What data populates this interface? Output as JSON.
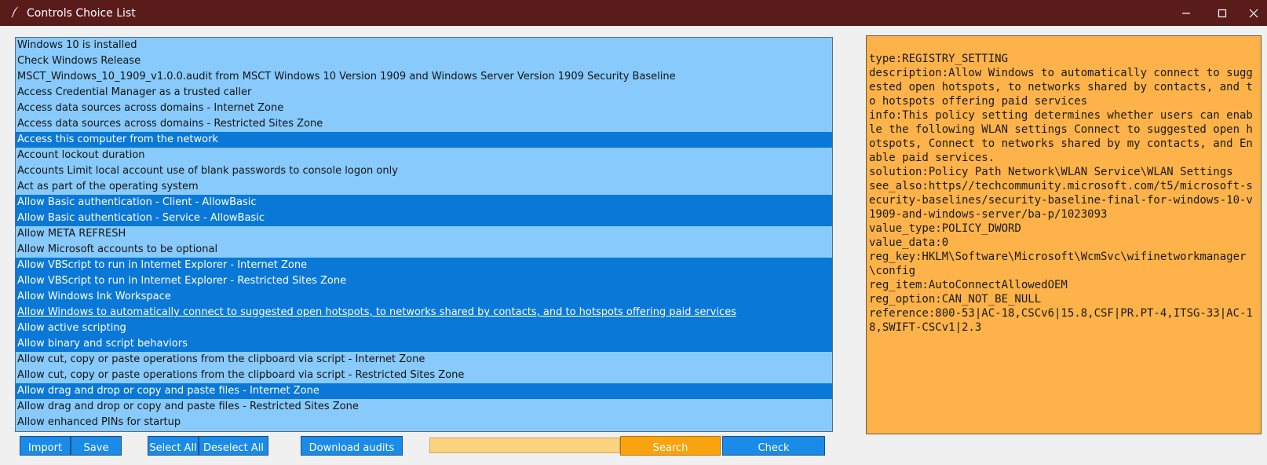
{
  "window": {
    "title": "Controls Choice List",
    "app_icon": "feather-icon",
    "controls": [
      "minimize-icon",
      "maximize-icon",
      "close-icon"
    ]
  },
  "list": {
    "items": [
      {
        "label": "Windows 10 is installed",
        "selected": false
      },
      {
        "label": "Check Windows Release",
        "selected": false
      },
      {
        "label": "MSCT_Windows_10_1909_v1.0.0.audit from MSCT Windows 10 Version 1909 and Windows Server Version 1909 Security Baseline",
        "selected": false
      },
      {
        "label": "Access Credential Manager as a trusted caller",
        "selected": false
      },
      {
        "label": "Access data sources across domains - Internet Zone",
        "selected": false
      },
      {
        "label": "Access data sources across domains - Restricted Sites Zone",
        "selected": false
      },
      {
        "label": "Access this computer from the network",
        "selected": true
      },
      {
        "label": "Account lockout duration",
        "selected": false
      },
      {
        "label": "Accounts Limit local account use of blank passwords to console logon only",
        "selected": false
      },
      {
        "label": "Act as part of the operating system",
        "selected": false
      },
      {
        "label": "Allow Basic authentication - Client - AllowBasic",
        "selected": true
      },
      {
        "label": "Allow Basic authentication - Service - AllowBasic",
        "selected": true
      },
      {
        "label": "Allow META REFRESH",
        "selected": false
      },
      {
        "label": "Allow Microsoft accounts to be optional",
        "selected": false
      },
      {
        "label": "Allow VBScript to run in Internet Explorer - Internet Zone",
        "selected": true
      },
      {
        "label": "Allow VBScript to run in Internet Explorer - Restricted Sites Zone",
        "selected": true
      },
      {
        "label": "Allow Windows Ink Workspace",
        "selected": true
      },
      {
        "label": "Allow Windows to automatically connect to suggested open hotspots, to networks shared by contacts, and to hotspots offering paid services",
        "selected": true,
        "active": true
      },
      {
        "label": "Allow active scripting",
        "selected": true
      },
      {
        "label": "Allow binary and script behaviors",
        "selected": true
      },
      {
        "label": "Allow cut, copy or paste operations from the clipboard via script - Internet Zone",
        "selected": false
      },
      {
        "label": "Allow cut, copy or paste operations from the clipboard via script - Restricted Sites Zone",
        "selected": false
      },
      {
        "label": "Allow drag and drop or copy and paste files - Internet Zone",
        "selected": true
      },
      {
        "label": "Allow drag and drop or copy and paste files - Restricted Sites Zone",
        "selected": false
      },
      {
        "label": "Allow enhanced PINs for startup",
        "selected": false
      }
    ]
  },
  "details": {
    "lines": [
      "type:REGISTRY_SETTING",
      "description:Allow Windows to automatically connect to suggested open hotspots, to networks shared by contacts, and to hotspots offering paid services",
      "info:This policy setting determines whether users can enable the following WLAN settings Connect to suggested open hotspots, Connect to networks shared by my contacts, and Enable paid services.",
      "solution:Policy Path Network\\WLAN Service\\WLAN Settings",
      "see_also:https//techcommunity.microsoft.com/t5/microsoft-security-baselines/security-baseline-final-for-windows-10-v1909-and-windows-server/ba-p/1023093",
      "value_type:POLICY_DWORD",
      "value_data:0",
      "reg_key:HKLM\\Software\\Microsoft\\WcmSvc\\wifinetworkmanager\\config",
      "reg_item:AutoConnectAllowedOEM",
      "reg_option:CAN_NOT_BE_NULL",
      "reference:800-53|AC-18,CSCv6|15.8,CSF|PR.PT-4,ITSG-33|AC-18,SWIFT-CSCv1|2.3"
    ]
  },
  "buttons": {
    "import": "Import",
    "save": "Save",
    "select_all": "Select All",
    "deselect_all": "Deselect All",
    "download_audits": "Download audits",
    "search": "Search",
    "check": "Check"
  },
  "search": {
    "value": "",
    "placeholder": ""
  },
  "colors": {
    "titlebar": "#5a1b1b",
    "list_bg": "#87cafb",
    "list_selected": "#0a78d7",
    "panel_bg": "#fdb349",
    "button_blue": "#1a8be8",
    "button_orange": "#f9a40e",
    "search_bg": "#ffd37d"
  }
}
